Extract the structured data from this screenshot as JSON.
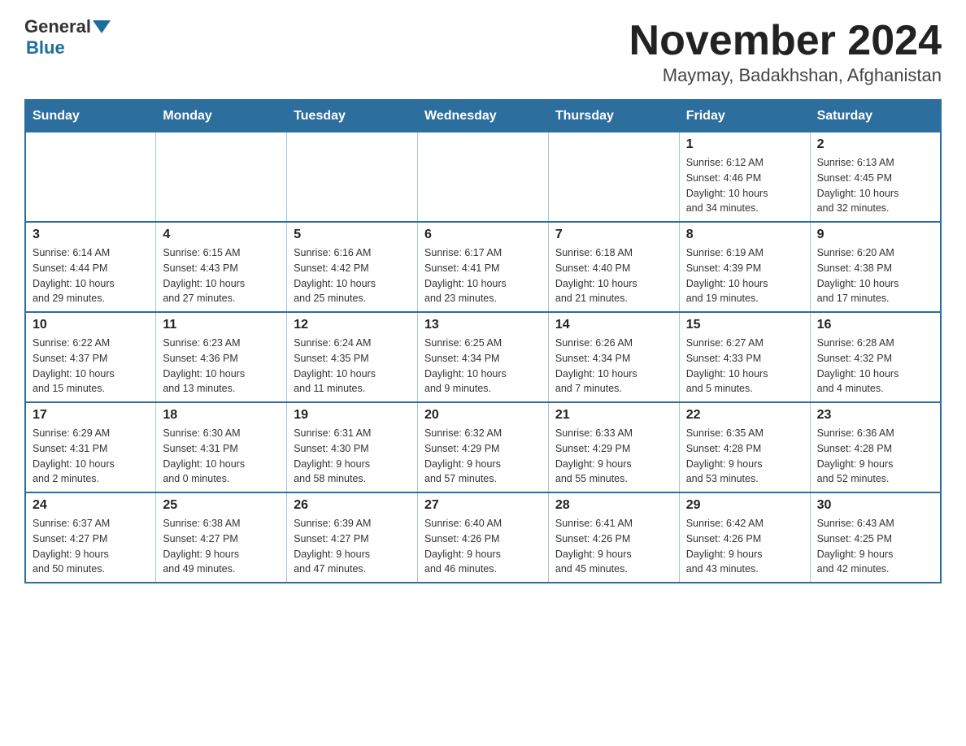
{
  "header": {
    "title": "November 2024",
    "subtitle": "Maymay, Badakhshan, Afghanistan",
    "logo_general": "General",
    "logo_blue": "Blue"
  },
  "weekdays": [
    "Sunday",
    "Monday",
    "Tuesday",
    "Wednesday",
    "Thursday",
    "Friday",
    "Saturday"
  ],
  "weeks": [
    [
      {
        "day": "",
        "info": ""
      },
      {
        "day": "",
        "info": ""
      },
      {
        "day": "",
        "info": ""
      },
      {
        "day": "",
        "info": ""
      },
      {
        "day": "",
        "info": ""
      },
      {
        "day": "1",
        "info": "Sunrise: 6:12 AM\nSunset: 4:46 PM\nDaylight: 10 hours\nand 34 minutes."
      },
      {
        "day": "2",
        "info": "Sunrise: 6:13 AM\nSunset: 4:45 PM\nDaylight: 10 hours\nand 32 minutes."
      }
    ],
    [
      {
        "day": "3",
        "info": "Sunrise: 6:14 AM\nSunset: 4:44 PM\nDaylight: 10 hours\nand 29 minutes."
      },
      {
        "day": "4",
        "info": "Sunrise: 6:15 AM\nSunset: 4:43 PM\nDaylight: 10 hours\nand 27 minutes."
      },
      {
        "day": "5",
        "info": "Sunrise: 6:16 AM\nSunset: 4:42 PM\nDaylight: 10 hours\nand 25 minutes."
      },
      {
        "day": "6",
        "info": "Sunrise: 6:17 AM\nSunset: 4:41 PM\nDaylight: 10 hours\nand 23 minutes."
      },
      {
        "day": "7",
        "info": "Sunrise: 6:18 AM\nSunset: 4:40 PM\nDaylight: 10 hours\nand 21 minutes."
      },
      {
        "day": "8",
        "info": "Sunrise: 6:19 AM\nSunset: 4:39 PM\nDaylight: 10 hours\nand 19 minutes."
      },
      {
        "day": "9",
        "info": "Sunrise: 6:20 AM\nSunset: 4:38 PM\nDaylight: 10 hours\nand 17 minutes."
      }
    ],
    [
      {
        "day": "10",
        "info": "Sunrise: 6:22 AM\nSunset: 4:37 PM\nDaylight: 10 hours\nand 15 minutes."
      },
      {
        "day": "11",
        "info": "Sunrise: 6:23 AM\nSunset: 4:36 PM\nDaylight: 10 hours\nand 13 minutes."
      },
      {
        "day": "12",
        "info": "Sunrise: 6:24 AM\nSunset: 4:35 PM\nDaylight: 10 hours\nand 11 minutes."
      },
      {
        "day": "13",
        "info": "Sunrise: 6:25 AM\nSunset: 4:34 PM\nDaylight: 10 hours\nand 9 minutes."
      },
      {
        "day": "14",
        "info": "Sunrise: 6:26 AM\nSunset: 4:34 PM\nDaylight: 10 hours\nand 7 minutes."
      },
      {
        "day": "15",
        "info": "Sunrise: 6:27 AM\nSunset: 4:33 PM\nDaylight: 10 hours\nand 5 minutes."
      },
      {
        "day": "16",
        "info": "Sunrise: 6:28 AM\nSunset: 4:32 PM\nDaylight: 10 hours\nand 4 minutes."
      }
    ],
    [
      {
        "day": "17",
        "info": "Sunrise: 6:29 AM\nSunset: 4:31 PM\nDaylight: 10 hours\nand 2 minutes."
      },
      {
        "day": "18",
        "info": "Sunrise: 6:30 AM\nSunset: 4:31 PM\nDaylight: 10 hours\nand 0 minutes."
      },
      {
        "day": "19",
        "info": "Sunrise: 6:31 AM\nSunset: 4:30 PM\nDaylight: 9 hours\nand 58 minutes."
      },
      {
        "day": "20",
        "info": "Sunrise: 6:32 AM\nSunset: 4:29 PM\nDaylight: 9 hours\nand 57 minutes."
      },
      {
        "day": "21",
        "info": "Sunrise: 6:33 AM\nSunset: 4:29 PM\nDaylight: 9 hours\nand 55 minutes."
      },
      {
        "day": "22",
        "info": "Sunrise: 6:35 AM\nSunset: 4:28 PM\nDaylight: 9 hours\nand 53 minutes."
      },
      {
        "day": "23",
        "info": "Sunrise: 6:36 AM\nSunset: 4:28 PM\nDaylight: 9 hours\nand 52 minutes."
      }
    ],
    [
      {
        "day": "24",
        "info": "Sunrise: 6:37 AM\nSunset: 4:27 PM\nDaylight: 9 hours\nand 50 minutes."
      },
      {
        "day": "25",
        "info": "Sunrise: 6:38 AM\nSunset: 4:27 PM\nDaylight: 9 hours\nand 49 minutes."
      },
      {
        "day": "26",
        "info": "Sunrise: 6:39 AM\nSunset: 4:27 PM\nDaylight: 9 hours\nand 47 minutes."
      },
      {
        "day": "27",
        "info": "Sunrise: 6:40 AM\nSunset: 4:26 PM\nDaylight: 9 hours\nand 46 minutes."
      },
      {
        "day": "28",
        "info": "Sunrise: 6:41 AM\nSunset: 4:26 PM\nDaylight: 9 hours\nand 45 minutes."
      },
      {
        "day": "29",
        "info": "Sunrise: 6:42 AM\nSunset: 4:26 PM\nDaylight: 9 hours\nand 43 minutes."
      },
      {
        "day": "30",
        "info": "Sunrise: 6:43 AM\nSunset: 4:25 PM\nDaylight: 9 hours\nand 42 minutes."
      }
    ]
  ]
}
